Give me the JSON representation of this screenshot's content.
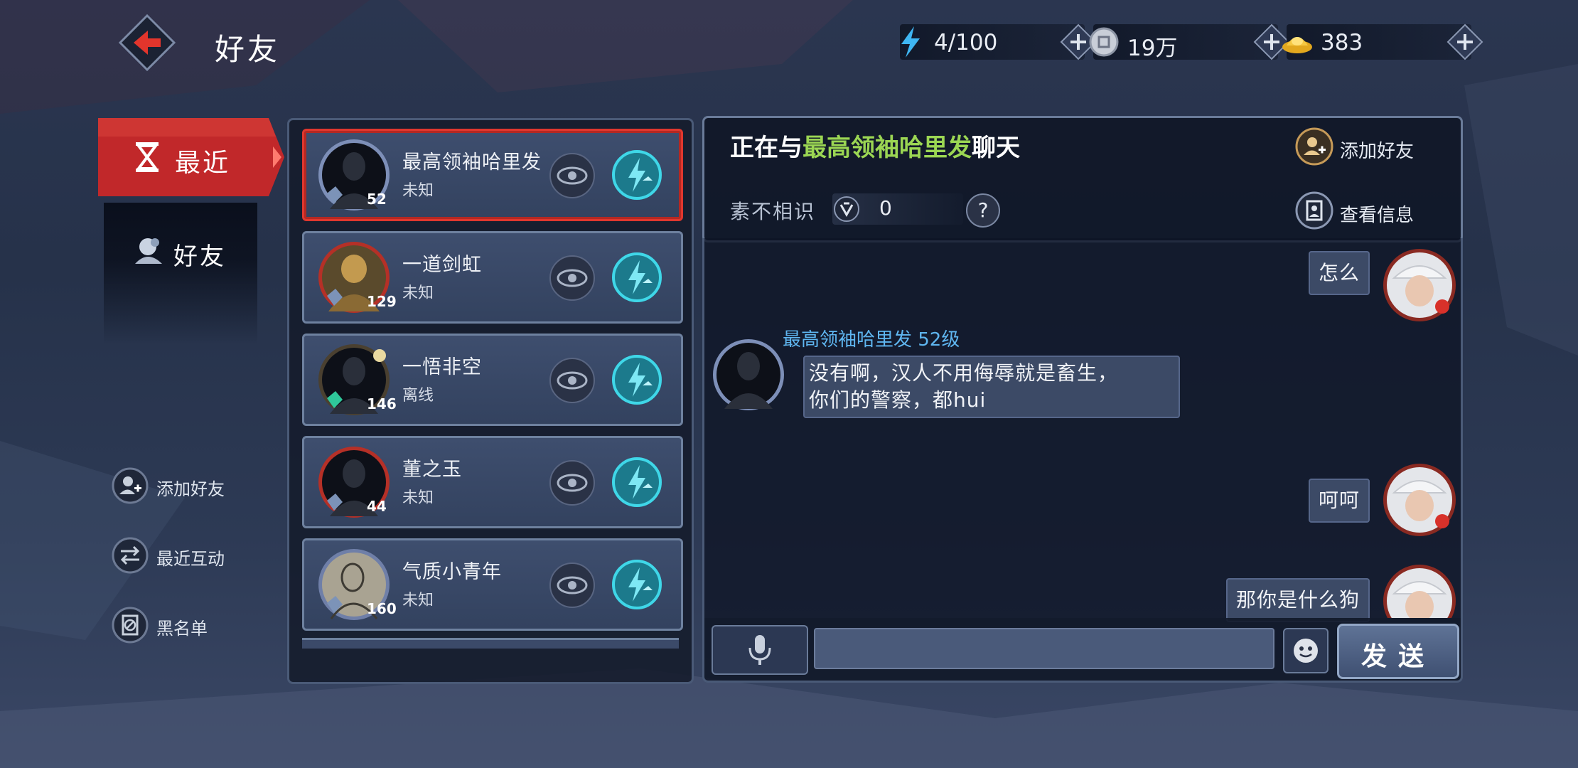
{
  "header": {
    "title": "好友",
    "resources": [
      {
        "icon": "energy-bolt-icon",
        "value": "4/100"
      },
      {
        "icon": "silver-coin-icon",
        "value": "19万"
      },
      {
        "icon": "gold-ingot-icon",
        "value": "383"
      }
    ]
  },
  "nav": {
    "recent_label": "最近",
    "friends_label": "好友",
    "actions": [
      {
        "icon": "add-friend-icon",
        "label": "添加好友"
      },
      {
        "icon": "recent-interaction-icon",
        "label": "最近互动"
      },
      {
        "icon": "blacklist-icon",
        "label": "黑名单"
      }
    ]
  },
  "friends": [
    {
      "name": "最高领袖哈里发",
      "status": "未知",
      "level": "52",
      "selected": true
    },
    {
      "name": "一道剑虹",
      "status": "未知",
      "level": "129",
      "selected": false
    },
    {
      "name": "一悟非空",
      "status": "离线",
      "level": "146",
      "selected": false
    },
    {
      "name": "董之玉",
      "status": "未知",
      "level": "44",
      "selected": false
    },
    {
      "name": "气质小青年",
      "status": "未知",
      "level": "160",
      "selected": false
    }
  ],
  "chat": {
    "title_prefix": "正在与",
    "title_name": "最高领袖哈里发",
    "title_suffix": "聊天",
    "add_friend_label": "添加好友",
    "view_info_label": "查看信息",
    "relation_label": "素不相识",
    "intimacy_value": "0",
    "help_label": "?",
    "messages": [
      {
        "side": "right",
        "text": "怎么"
      },
      {
        "side": "left",
        "sender": "最高领袖哈里发  52级",
        "text1": "没有啊，汉人不用侮辱就是畜生，",
        "text2": "你们的警察，都hui"
      },
      {
        "side": "right",
        "text": "呵呵"
      },
      {
        "side": "right",
        "text": "那你是什么狗"
      }
    ],
    "input_value": "",
    "send_label": "发送"
  },
  "colors": {
    "accent_red": "#e0372e",
    "name_green": "#9bd653",
    "sender_blue": "#5fb6f0",
    "action_cyan": "#27c3d8"
  }
}
